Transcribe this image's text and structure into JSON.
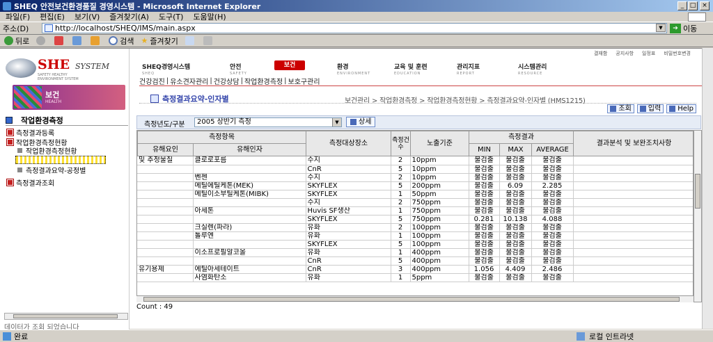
{
  "window": {
    "title": "SHEQ 안전보건환경품질 경영시스템 - Microsoft Internet Explorer",
    "min": "_",
    "max": "□",
    "close": "×"
  },
  "menu": [
    "파일(F)",
    "편집(E)",
    "보기(V)",
    "즐겨찾기(A)",
    "도구(T)",
    "도움말(H)"
  ],
  "address": {
    "label": "주소(D)",
    "url": "http://localhost/SHEQ/IMS/main.aspx",
    "go": "이동"
  },
  "toolbar": {
    "back": "뒤로",
    "search": "검색",
    "favorites": "즐겨찾기"
  },
  "logo": {
    "she": "SHE",
    "system": "SYSTEM",
    "tagline1": "SAFETY HEALTHY",
    "tagline2": "ENVIRONMENT SYSTEM"
  },
  "section": {
    "title": "보건",
    "en": "HEALTH"
  },
  "tree": {
    "title": "작업환경측정",
    "nodes": [
      {
        "label": "측정결과등록"
      },
      {
        "label": "작업환경측정현황"
      },
      {
        "label": "작업환경측정현황"
      },
      {
        "label": "측정결과요약-공정별"
      },
      {
        "label": "측정결과조회"
      }
    ]
  },
  "left_status": "데이터가 조회 되었습니다",
  "topnav": {
    "utility": [
      "결재함",
      "공지사항",
      "일정표",
      "비밀번호변경"
    ],
    "items": [
      {
        "label": "SHEQ경영시스템",
        "en": "SHEQ"
      },
      {
        "label": "안전",
        "en": "SAFETY"
      },
      {
        "label": "보건",
        "en": ""
      },
      {
        "label": "환경",
        "en": "ENVIRONMENT"
      },
      {
        "label": "교육 및 훈련",
        "en": "EDUCATION"
      },
      {
        "label": "관리지표",
        "en": "REPORT"
      },
      {
        "label": "시스템관리",
        "en": "RESOURCE"
      }
    ],
    "sub": [
      "건강검진",
      "|",
      "유소견자관리",
      "|",
      "건강상담",
      "|",
      "작업환경측정",
      "|",
      "보호구관리"
    ]
  },
  "page": {
    "title": "측정결과요약-인자별",
    "breadcrumb": "보건관리 > 작업환경측정 > 작업환경측정현황 > 측정결과요약-인자별 (HMS1215)",
    "actions": [
      "조회",
      "입력",
      "Help"
    ]
  },
  "filter": {
    "label": "측정년도/구분",
    "value": "2005 상반기 측정",
    "detail": "상세"
  },
  "table": {
    "header": {
      "group": "측정항목",
      "col1": "유해요인",
      "col2": "유해인자",
      "col3": "측정대상장소",
      "col4": "측정건수",
      "col5": "노출기준",
      "result": "측정결과",
      "min": "MIN",
      "max": "MAX",
      "avg": "AVERAGE",
      "note": "결과분석 및 보완조치사항"
    },
    "rows": [
      {
        "f": "및 추정물질",
        "h": "클로로포름",
        "p": "수지",
        "n": "2",
        "e": "10ppm",
        "mn": "불검출",
        "mx": "불검출",
        "av": "불검출"
      },
      {
        "f": "",
        "h": "",
        "p": "CnR",
        "n": "5",
        "e": "10ppm",
        "mn": "불검출",
        "mx": "불검출",
        "av": "불검출"
      },
      {
        "f": "",
        "h": "벤젠",
        "p": "수지",
        "n": "2",
        "e": "10ppm",
        "mn": "불검출",
        "mx": "불검출",
        "av": "불검출"
      },
      {
        "f": "",
        "h": "메틸에틸케톤(MEK)",
        "p": "SKYFLEX",
        "n": "5",
        "e": "200ppm",
        "mn": "불검출",
        "mx": "6.09",
        "av": "2.285"
      },
      {
        "f": "",
        "h": "메틸이소부틸케톤(MIBK)",
        "p": "SKYFLEX",
        "n": "1",
        "e": "50ppm",
        "mn": "불검출",
        "mx": "불검출",
        "av": "불검출"
      },
      {
        "f": "",
        "h": "",
        "p": "수지",
        "n": "2",
        "e": "750ppm",
        "mn": "불검출",
        "mx": "불검출",
        "av": "불검출"
      },
      {
        "f": "",
        "h": "아세톤",
        "p": "Huvis SF생산",
        "n": "1",
        "e": "750ppm",
        "mn": "불검출",
        "mx": "불검출",
        "av": "불검출"
      },
      {
        "f": "",
        "h": "",
        "p": "SKYFLEX",
        "n": "5",
        "e": "750ppm",
        "mn": "0.281",
        "mx": "10.138",
        "av": "4.088"
      },
      {
        "f": "",
        "h": "크실렌(파라)",
        "p": "유화",
        "n": "2",
        "e": "100ppm",
        "mn": "불검출",
        "mx": "불검출",
        "av": "불검출"
      },
      {
        "f": "",
        "h": "톨루엔",
        "p": "유화",
        "n": "1",
        "e": "100ppm",
        "mn": "불검출",
        "mx": "불검출",
        "av": "불검출"
      },
      {
        "f": "",
        "h": "",
        "p": "SKYFLEX",
        "n": "5",
        "e": "100ppm",
        "mn": "불검출",
        "mx": "불검출",
        "av": "불검출"
      },
      {
        "f": "",
        "h": "이소프로필알코올",
        "p": "유화",
        "n": "1",
        "e": "400ppm",
        "mn": "불검출",
        "mx": "불검출",
        "av": "불검출"
      },
      {
        "f": "",
        "h": "",
        "p": "CnR",
        "n": "5",
        "e": "400ppm",
        "mn": "불검출",
        "mx": "불검출",
        "av": "불검출"
      },
      {
        "f": "유기용제",
        "h": "에틸아세테이트",
        "p": "CnR",
        "n": "3",
        "e": "400ppm",
        "mn": "1.056",
        "mx": "4.409",
        "av": "2.486"
      },
      {
        "f": "",
        "h": "사염화탄소",
        "p": "유화",
        "n": "1",
        "e": "5ppm",
        "mn": "불검출",
        "mx": "불검출",
        "av": "불검출"
      }
    ],
    "count": "Count : 49"
  },
  "status": {
    "left": "완료",
    "zone": "로컬 인트라넷"
  },
  "colors": {
    "accent": "#c00000",
    "titlebar": "#0a246a",
    "link": "#3344aa"
  }
}
